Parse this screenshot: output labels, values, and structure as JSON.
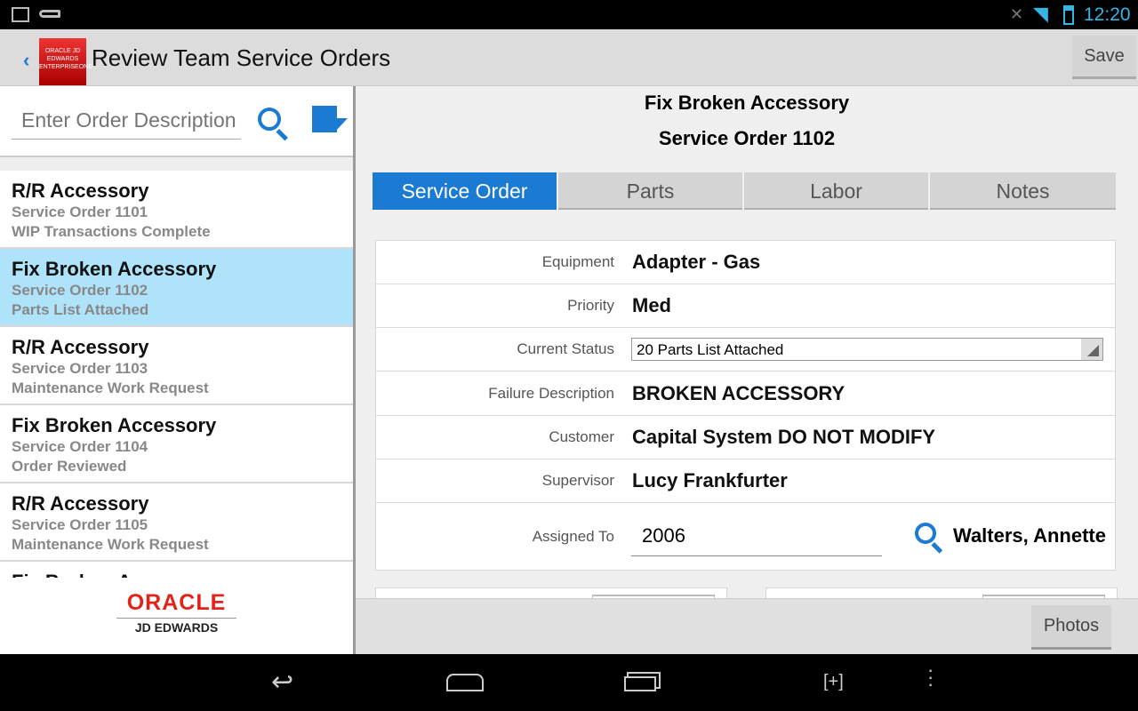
{
  "status_bar": {
    "time": "12:20",
    "icons": [
      "image-icon",
      "key-icon",
      "mute-icon",
      "wifi-icon",
      "battery-icon"
    ]
  },
  "app_bar": {
    "title": "Review Team Service Orders",
    "save_label": "Save",
    "logo_text": "ORACLE JD EDWARDS ENTERPRISEONE"
  },
  "search": {
    "placeholder": "Enter Order Description",
    "value": ""
  },
  "orders": [
    {
      "title": "R/R Accessory",
      "order": "Service Order 1101",
      "status": "WIP Transactions Complete",
      "selected": false
    },
    {
      "title": "Fix Broken Accessory",
      "order": "Service Order 1102",
      "status": "Parts List Attached",
      "selected": true
    },
    {
      "title": "R/R Accessory",
      "order": "Service Order 1103",
      "status": "Maintenance Work Request",
      "selected": false
    },
    {
      "title": "Fix Broken Accessory",
      "order": "Service Order 1104",
      "status": "Order Reviewed",
      "selected": false
    },
    {
      "title": "R/R Accessory",
      "order": "Service Order 1105",
      "status": "Maintenance Work Request",
      "selected": false
    },
    {
      "title": "Fix Broken Accessory",
      "order": "",
      "status": "",
      "selected": false
    }
  ],
  "footer_logo": {
    "brand": "ORACLE",
    "sub": "JD EDWARDS"
  },
  "detail": {
    "title": "Fix Broken Accessory",
    "subtitle": "Service Order 1102",
    "tabs": [
      "Service Order",
      "Parts",
      "Labor",
      "Notes"
    ],
    "active_tab": "Service Order",
    "fields": {
      "equipment": {
        "label": "Equipment",
        "value": "Adapter - Gas"
      },
      "priority": {
        "label": "Priority",
        "value": "Med"
      },
      "current_status": {
        "label": "Current Status",
        "value": "20 Parts List Attached"
      },
      "failure": {
        "label": "Failure Description",
        "value": "BROKEN ACCESSORY"
      },
      "customer": {
        "label": "Customer",
        "value": "Capital System DO NOT MODIFY"
      },
      "supervisor": {
        "label": "Supervisor",
        "value": "Lucy Frankfurter"
      },
      "assigned": {
        "label": "Assigned To",
        "value": "2006",
        "name": "Walters, Annette"
      }
    }
  },
  "bottom": {
    "photos_label": "Photos"
  },
  "colors": {
    "accent": "#1b7ad2",
    "selected_row": "#aee3fa",
    "oracle_red": "#e2231a"
  }
}
